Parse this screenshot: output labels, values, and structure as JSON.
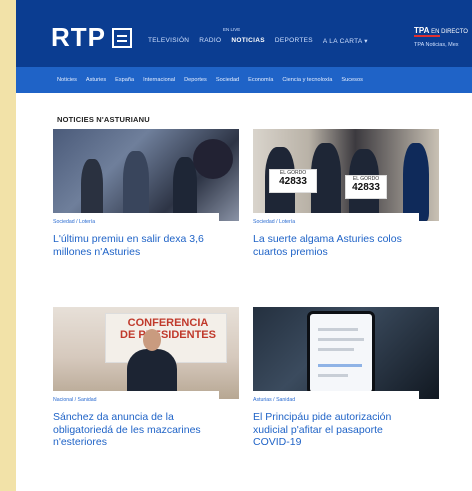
{
  "header": {
    "logo_text": "RTP",
    "live_tag": "EN LIVE",
    "nav": [
      "TELEVISIÓN",
      "RADIO",
      "NOTICIAS",
      "DEPORTES",
      "A LA CARTA ▾"
    ],
    "active_nav": "NOTICIAS",
    "right_brand": "TPA",
    "right_brand_suffix": "EN DIRECTO",
    "right_sub": "TPA Noticias, Mex"
  },
  "subnav": [
    "Noticies",
    "Asturies",
    "España",
    "Internacional",
    "Deportes",
    "Sociedad",
    "Economía",
    "Ciencia y tecnoloxía",
    "Sucesos"
  ],
  "section": {
    "title": "NOTICIES N'ASTURIANU"
  },
  "articles": [
    {
      "tag": "Sociedad / Lotería",
      "headline": "L'últimu premiu en salir dexa 3,6 millones n'Asturies"
    },
    {
      "tag": "Sociedad / Lotería",
      "headline": "La suerte algama Asturies colos cuartos premios",
      "image_signs": [
        "42833",
        "42833"
      ],
      "sign_caption": "EL GORDO"
    },
    {
      "tag": "Nacional / Sanidad",
      "headline": "Sánchez da anuncia de la obligatoriedá de les mazcarines n'esteriores",
      "image_text": [
        "CONFERENCIA",
        "DE PRESIDENTES"
      ]
    },
    {
      "tag": "Asturias / Sanidad",
      "headline": "El Principáu pide autorización xudicial p'afitar el pasaporte COVID-19"
    }
  ],
  "colors": {
    "header_bg": "#0b3d91",
    "subnav_bg": "#1f63c7",
    "headline": "#1f63c7",
    "page_bg": "#f2e2a8"
  }
}
